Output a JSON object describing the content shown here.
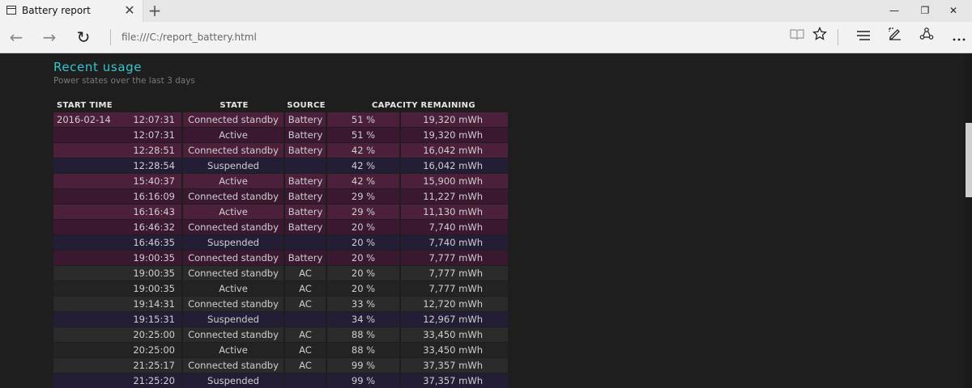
{
  "browser": {
    "tab_title": "Battery report",
    "tab_close_glyph": "✕",
    "new_tab_glyph": "+",
    "window_minimize_glyph": "—",
    "window_restore_glyph": "❐",
    "window_close_glyph": "✕",
    "back_glyph": "←",
    "forward_glyph": "→",
    "refresh_glyph": "↻",
    "address": "file:///C:/report_battery.html",
    "tools": [
      "reading-view-icon",
      "favorites-star-icon",
      "hub-icon",
      "web-note-icon",
      "share-icon",
      "more-icon"
    ]
  },
  "report": {
    "title": "Recent usage",
    "subtitle": "Power states over the last 3 days",
    "headers": {
      "start_time": "START TIME",
      "state": "STATE",
      "source": "SOURCE",
      "capacity": "CAPACITY REMAINING"
    },
    "rows": [
      {
        "date": "2016-02-14",
        "time": "12:07:31",
        "state": "Connected standby",
        "source": "Battery",
        "pct": "51 %",
        "mwh": "19,320 mWh",
        "kind": "standby"
      },
      {
        "date": "",
        "time": "12:07:31",
        "state": "Active",
        "source": "Battery",
        "pct": "51 %",
        "mwh": "19,320 mWh",
        "kind": "active"
      },
      {
        "date": "",
        "time": "12:28:51",
        "state": "Connected standby",
        "source": "Battery",
        "pct": "42 %",
        "mwh": "16,042 mWh",
        "kind": "standby"
      },
      {
        "date": "",
        "time": "12:28:54",
        "state": "Suspended",
        "source": "",
        "pct": "42 %",
        "mwh": "16,042 mWh",
        "kind": "suspended"
      },
      {
        "date": "",
        "time": "15:40:37",
        "state": "Active",
        "source": "Battery",
        "pct": "42 %",
        "mwh": "15,900 mWh",
        "kind": "standby"
      },
      {
        "date": "",
        "time": "16:16:09",
        "state": "Connected standby",
        "source": "Battery",
        "pct": "29 %",
        "mwh": "11,227 mWh",
        "kind": "active"
      },
      {
        "date": "",
        "time": "16:16:43",
        "state": "Active",
        "source": "Battery",
        "pct": "29 %",
        "mwh": "11,130 mWh",
        "kind": "standby"
      },
      {
        "date": "",
        "time": "16:46:32",
        "state": "Connected standby",
        "source": "Battery",
        "pct": "20 %",
        "mwh": "7,740 mWh",
        "kind": "active"
      },
      {
        "date": "",
        "time": "16:46:35",
        "state": "Suspended",
        "source": "",
        "pct": "20 %",
        "mwh": "7,740 mWh",
        "kind": "suspended"
      },
      {
        "date": "",
        "time": "19:00:35",
        "state": "Connected standby",
        "source": "Battery",
        "pct": "20 %",
        "mwh": "7,777 mWh",
        "kind": "active"
      },
      {
        "date": "",
        "time": "19:00:35",
        "state": "Connected standby",
        "source": "AC",
        "pct": "20 %",
        "mwh": "7,777 mWh",
        "kind": "ac-standby"
      },
      {
        "date": "",
        "time": "19:00:35",
        "state": "Active",
        "source": "AC",
        "pct": "20 %",
        "mwh": "7,777 mWh",
        "kind": "ac-active"
      },
      {
        "date": "",
        "time": "19:14:31",
        "state": "Connected standby",
        "source": "AC",
        "pct": "33 %",
        "mwh": "12,720 mWh",
        "kind": "ac-standby"
      },
      {
        "date": "",
        "time": "19:15:31",
        "state": "Suspended",
        "source": "",
        "pct": "34 %",
        "mwh": "12,967 mWh",
        "kind": "suspended"
      },
      {
        "date": "",
        "time": "20:25:00",
        "state": "Connected standby",
        "source": "AC",
        "pct": "88 %",
        "mwh": "33,450 mWh",
        "kind": "ac-standby"
      },
      {
        "date": "",
        "time": "20:25:00",
        "state": "Active",
        "source": "AC",
        "pct": "88 %",
        "mwh": "33,450 mWh",
        "kind": "ac-active"
      },
      {
        "date": "",
        "time": "21:25:17",
        "state": "Connected standby",
        "source": "AC",
        "pct": "99 %",
        "mwh": "37,357 mWh",
        "kind": "ac-standby"
      },
      {
        "date": "",
        "time": "21:25:20",
        "state": "Suspended",
        "source": "",
        "pct": "99 %",
        "mwh": "37,357 mWh",
        "kind": "suspended"
      }
    ]
  }
}
